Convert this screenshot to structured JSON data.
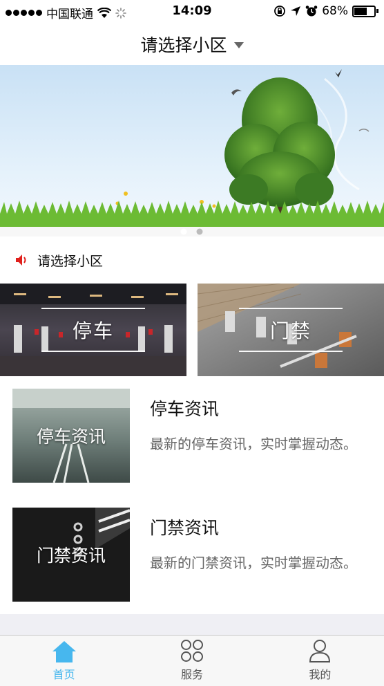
{
  "status_bar": {
    "carrier": "中国联通",
    "time": "14:09",
    "battery": "68%",
    "battery_level": 0.68
  },
  "nav": {
    "title": "请选择小区"
  },
  "banner": {
    "page_count": 2,
    "active_page": 1
  },
  "notice": {
    "text": "请选择小区",
    "icon": "speaker-icon"
  },
  "tiles": [
    {
      "label": "停车"
    },
    {
      "label": "门禁"
    }
  ],
  "news": [
    {
      "thumb_label": "停车资讯",
      "title": "停车资讯",
      "desc": "最新的停车资讯，实时掌握动态。"
    },
    {
      "thumb_label": "门禁资讯",
      "title": "门禁资讯",
      "desc": "最新的门禁资讯，实时掌握动态。"
    }
  ],
  "tabbar": {
    "items": [
      {
        "label": "首页",
        "icon": "home-icon",
        "active": true
      },
      {
        "label": "服务",
        "icon": "services-grid-icon",
        "active": false
      },
      {
        "label": "我的",
        "icon": "profile-icon",
        "active": false
      }
    ],
    "active_color": "#47b7ee"
  }
}
